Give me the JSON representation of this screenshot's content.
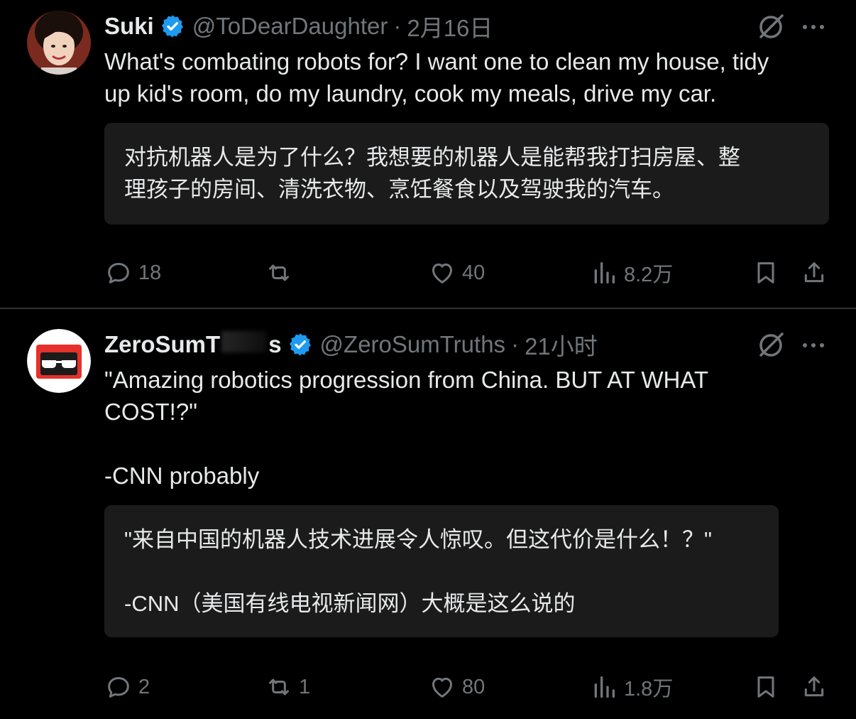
{
  "tweets": [
    {
      "name": "Suki",
      "handle": "@ToDearDaughter",
      "separator": "·",
      "time": "2月16日",
      "text": "What's combating robots for? I want one to clean my house, tidy\nup kid's room, do my laundry, cook my meals, drive my car.",
      "translation": "对抗机器人是为了什么？我想要的机器人是能帮我打扫房屋、整\n理孩子的房间、清洗衣物、烹饪餐食以及驾驶我的汽车。",
      "replies": "18",
      "reposts": "",
      "likes": "40",
      "views": "8.2万"
    },
    {
      "name_start": "ZeroSumT",
      "name_end": "s",
      "handle": "@ZeroSumTruths",
      "separator": "·",
      "time": "21小时",
      "text": "\"Amazing robotics progression from China. BUT AT WHAT\nCOST!?\"\n\n-CNN probably",
      "translation": "\"来自中国的机器人技术进展令人惊叹。但这代价是什么！？\"\n\n-CNN（美国有线电视新闻网）大概是这么说的",
      "replies": "2",
      "reposts": "1",
      "likes": "80",
      "views": "1.8万"
    }
  ],
  "colors": {
    "background": "#000000",
    "text": "#e7e9ea",
    "muted": "#71767b",
    "verified": "#1d9bf0",
    "translation_box": "#1c1b1b"
  },
  "icons": [
    "verified-badge-icon",
    "grok-icon",
    "more-icon",
    "reply-icon",
    "repost-icon",
    "like-icon",
    "views-icon",
    "bookmark-icon",
    "share-icon"
  ]
}
